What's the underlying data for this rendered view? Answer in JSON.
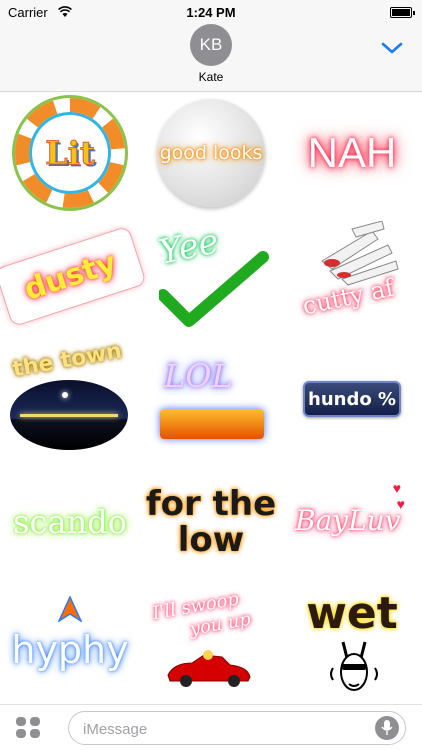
{
  "status_bar": {
    "carrier": "Carrier",
    "time": "1:24 PM"
  },
  "header": {
    "avatar_initials": "KB",
    "contact_name": "Kate",
    "chevron_icon": "chevron-down-icon",
    "accent_color": "#1a7cf5"
  },
  "stickers": [
    {
      "id": "lit",
      "text": "Lit"
    },
    {
      "id": "good-looks",
      "text": "good looks"
    },
    {
      "id": "nah",
      "text": "NAH"
    },
    {
      "id": "dusty",
      "text": "dusty"
    },
    {
      "id": "yee",
      "text": "Yee"
    },
    {
      "id": "cutty-af",
      "text": "cutty af"
    },
    {
      "id": "the-town",
      "text": "the town"
    },
    {
      "id": "lol",
      "text": "LOL"
    },
    {
      "id": "hundo",
      "text": "hundo %"
    },
    {
      "id": "scando",
      "text": "scando"
    },
    {
      "id": "for-the-low",
      "line1": "for the",
      "line2": "low"
    },
    {
      "id": "bayluv",
      "text": "BayLuv"
    },
    {
      "id": "hyphy",
      "text": "hyphy"
    },
    {
      "id": "swoop",
      "line1": "I'll swoop",
      "line2": "you up"
    },
    {
      "id": "wet",
      "text": "wet"
    }
  ],
  "input_bar": {
    "placeholder": "iMessage",
    "apps_icon": "apps-icon",
    "mic_icon": "microphone-icon"
  }
}
